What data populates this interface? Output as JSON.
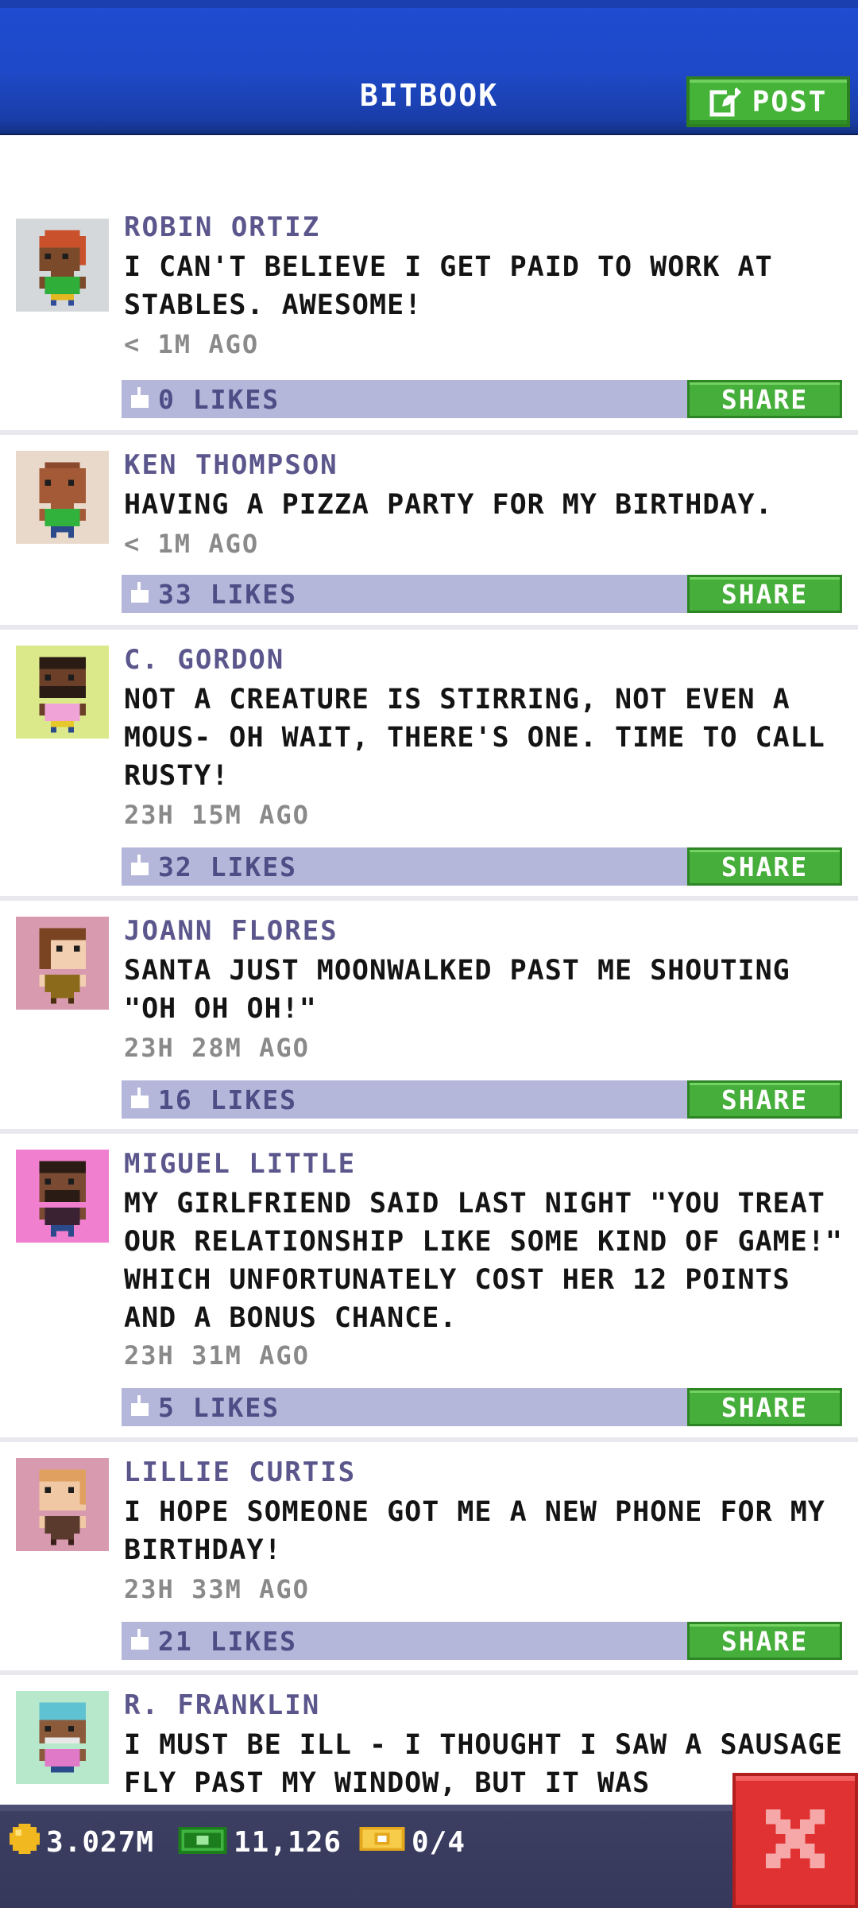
{
  "header": {
    "title": "BITBOOK",
    "post_label": "POST"
  },
  "posts": [
    {
      "name": "ROBIN ORTIZ",
      "text": "I CAN'T BELIEVE I GET PAID TO WORK AT STABLES. AWESOME!",
      "time": "< 1M AGO",
      "likes": "0 LIKES",
      "share": "SHARE"
    },
    {
      "name": "KEN THOMPSON",
      "text": "HAVING A PIZZA PARTY FOR MY BIRTHDAY.",
      "time": "< 1M AGO",
      "likes": "33 LIKES",
      "share": "SHARE"
    },
    {
      "name": "C. GORDON",
      "text": "NOT A CREATURE IS STIRRING, NOT EVEN A MOUS- OH WAIT, THERE'S ONE. TIME TO CALL RUSTY!",
      "time": "23H 15M AGO",
      "likes": "32 LIKES",
      "share": "SHARE"
    },
    {
      "name": "JOANN FLORES",
      "text": "SANTA JUST MOONWALKED PAST ME SHOUTING \"OH OH OH!\"",
      "time": "23H 28M AGO",
      "likes": "16 LIKES",
      "share": "SHARE"
    },
    {
      "name": "MIGUEL LITTLE",
      "text": "MY GIRLFRIEND SAID LAST NIGHT \"YOU TREAT OUR RELATIONSHIP LIKE SOME KIND OF GAME!\" WHICH UNFORTUNATELY COST HER 12 POINTS AND A BONUS CHANCE.",
      "time": "23H 31M AGO",
      "likes": "5 LIKES",
      "share": "SHARE"
    },
    {
      "name": "LILLIE CURTIS",
      "text": "I HOPE SOMEONE GOT ME A NEW PHONE FOR MY BIRTHDAY!",
      "time": "23H 33M AGO",
      "likes": "21 LIKES",
      "share": "SHARE"
    },
    {
      "name": "R. FRANKLIN",
      "text": "I MUST BE ILL - I THOUGHT I SAW A SAUSAGE FLY PAST MY WINDOW, BUT IT WAS",
      "time": "",
      "likes": "",
      "share": ""
    }
  ],
  "status": {
    "coins": "3.027M",
    "bux": "11,126",
    "tickets": "0/4"
  },
  "colors": {
    "header_blue": "#1e49c8",
    "share_green": "#46ae3a",
    "like_bar": "#b4b6da",
    "close_red": "#e03232"
  }
}
